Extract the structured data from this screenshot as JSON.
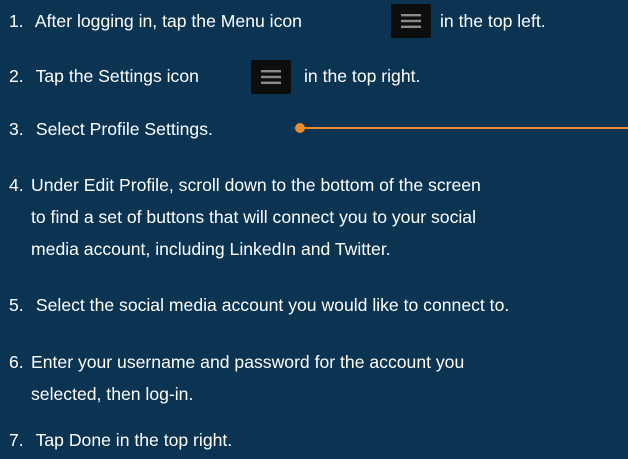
{
  "steps": [
    {
      "num": "1.",
      "before": "After logging in, tap the Menu icon",
      "icon": "hamburger-menu-icon",
      "after": "in the top left."
    },
    {
      "num": "2.",
      "before": "Tap the Settings icon",
      "icon": "hamburger-menu-icon",
      "after": "in the top right."
    },
    {
      "num": "3.",
      "text": "Select Profile Settings."
    },
    {
      "num": "4.",
      "lines": [
        "Under Edit Profile, scroll down to the bottom of the screen",
        "to find a set of buttons that will connect you to your social",
        "media account, including LinkedIn and Twitter."
      ]
    },
    {
      "num": "5.",
      "text": "Select the social media account you would like to connect to."
    },
    {
      "num": "6.",
      "lines": [
        "Enter your username and password for the account you",
        "selected, then log-in."
      ]
    },
    {
      "num": "7.",
      "text": "Tap Done in the top right."
    }
  ],
  "colors": {
    "background": "#0b3352",
    "text": "#ffffff",
    "callout": "#e98a2d",
    "icon_bg": "#0d0d0d"
  }
}
